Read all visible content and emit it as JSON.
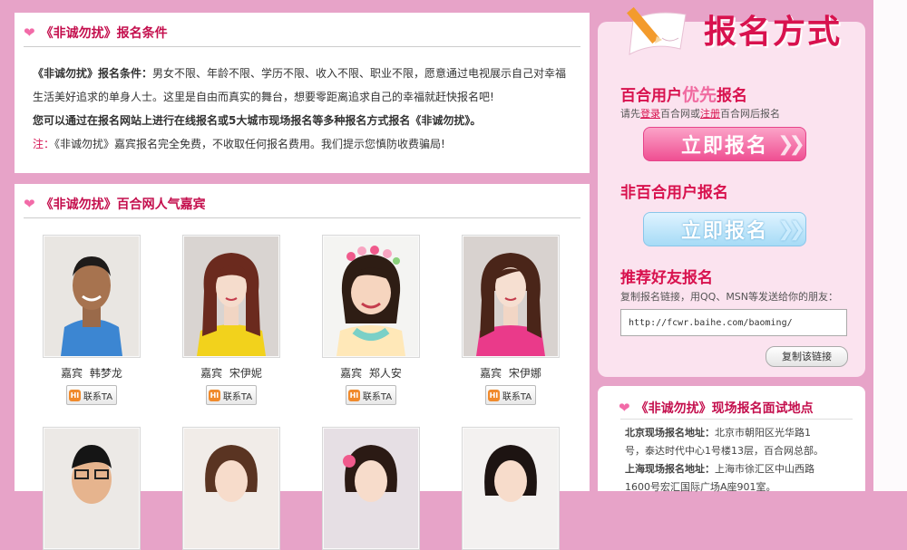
{
  "left_top": {
    "title": "《非诚勿扰》报名条件",
    "cond_label": "《非诚勿扰》报名条件：",
    "cond_text": "男女不限、年龄不限、学历不限、收入不限、职业不限，愿意通过电视展示自己对幸福生活美好追求的单身人士。这里是自由而真实的舞台，想要零距离追求自己的幸福就赶快报名吧!",
    "line2": "您可以通过在报名网站上进行在线报名或5大城市现场报名等多种报名方式报名《非诚勿扰》。",
    "note_label": "注：",
    "note_text": "《非诚勿扰》嘉宾报名完全免费，不收取任何报名费用。我们提示您慎防收费骗局!"
  },
  "guests_section": {
    "title": "《非诚勿扰》百合网人气嘉宾",
    "contact_label": "联系TA",
    "hi_icon": "HI",
    "guests": [
      {
        "role": "嘉宾",
        "name": "韩梦龙"
      },
      {
        "role": "嘉宾",
        "name": "宋伊妮"
      },
      {
        "role": "嘉宾",
        "name": "郑人安"
      },
      {
        "role": "嘉宾",
        "name": "宋伊娜"
      }
    ]
  },
  "register": {
    "title": "报名方式",
    "baihe_title_a": "百合用户",
    "baihe_title_b": "优先",
    "baihe_title_c": "报名",
    "baihe_sub_a": "请先",
    "baihe_login": "登录",
    "baihe_sub_b": "百合网或",
    "baihe_register": "注册",
    "baihe_sub_c": "百合网后报名",
    "signup_btn": "立即报名",
    "non_title": "非百合用户报名",
    "signup_btn2": "立即报名",
    "refer_title": "推荐好友报名",
    "refer_sub": "复制报名链接，用QQ、MSN等发送给你的朋友：",
    "refer_url": "http://fcwr.baihe.com/baoming/",
    "copy_btn": "复制该链接"
  },
  "locations": {
    "title": "《非诚勿扰》现场报名面试地点",
    "bj_label": "北京现场报名地址：",
    "bj_text_a": "北京市朝阳区光华路1",
    "bj_text_b": "号，泰达时代中心1号楼13层，百合网总部。",
    "sh_label": "上海现场报名地址：",
    "sh_text_a": "上海市徐汇区中山西路",
    "sh_text_b": "1600号宏汇国际广场A座901室。"
  },
  "colors": {
    "accent": "#d8124e",
    "bg": "#e7a3c8"
  }
}
